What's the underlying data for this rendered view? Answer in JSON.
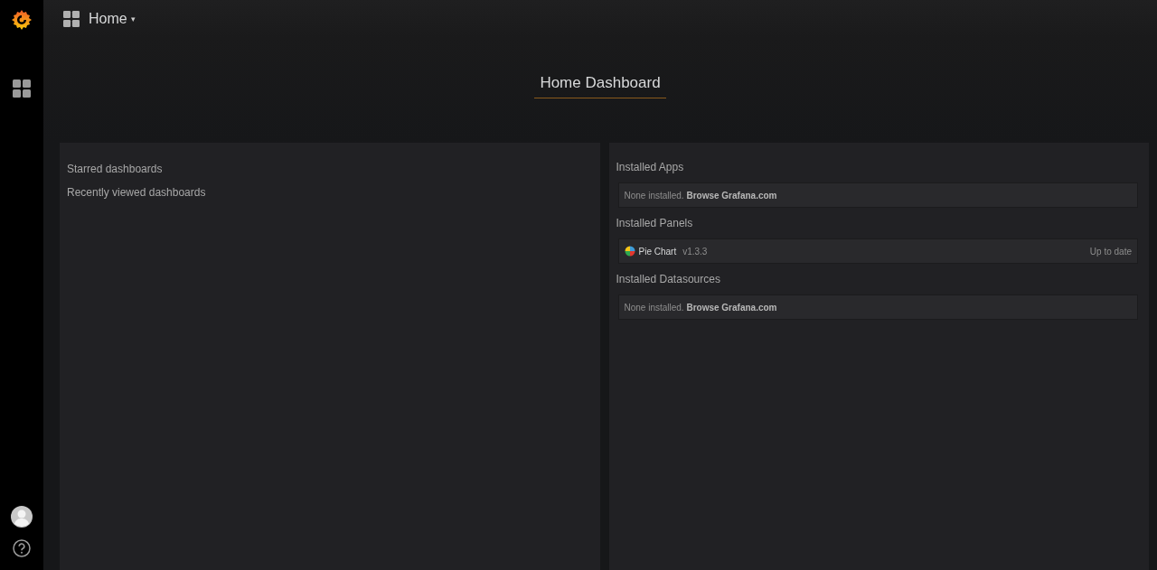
{
  "topbar": {
    "title": "Home",
    "caret": "▾"
  },
  "header": {
    "title": "Home Dashboard"
  },
  "left_panel": {
    "sections": [
      "Starred dashboards",
      "Recently viewed dashboards"
    ]
  },
  "right_panel": {
    "sections": [
      {
        "title": "Installed Apps",
        "items": [
          {
            "kind": "empty",
            "text": "None installed.",
            "link": "Browse Grafana.com"
          }
        ]
      },
      {
        "title": "Installed Panels",
        "items": [
          {
            "kind": "plugin",
            "name": "Pie Chart",
            "version": "v1.3.3",
            "status": "Up to date"
          }
        ]
      },
      {
        "title": "Installed Datasources",
        "items": [
          {
            "kind": "empty",
            "text": "None installed.",
            "link": "Browse Grafana.com"
          }
        ]
      }
    ]
  }
}
